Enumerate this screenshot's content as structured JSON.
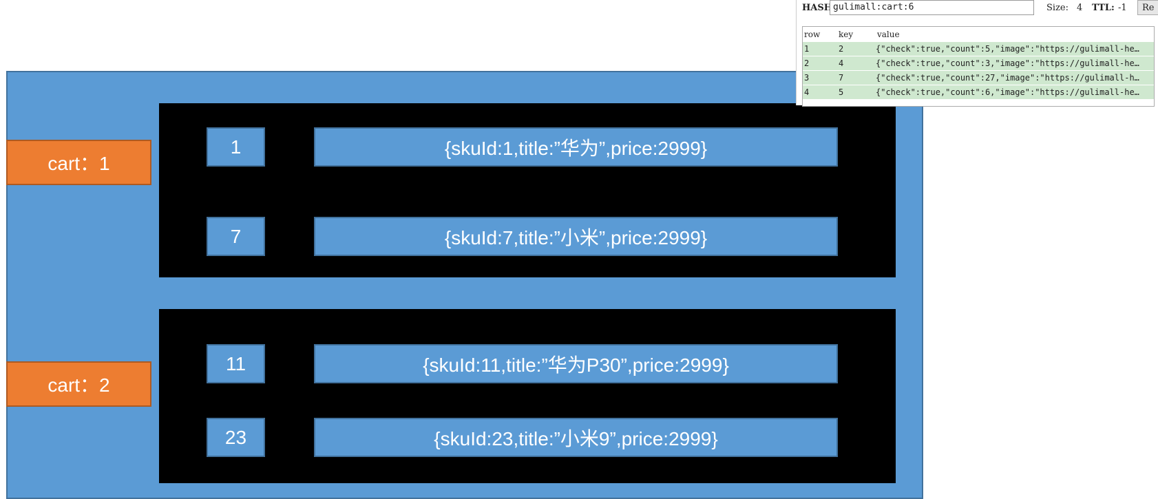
{
  "diagram": {
    "carts": [
      {
        "label": "cart：1",
        "items": [
          {
            "key": "1",
            "value": "{skuId:1,title:”华为”,price:2999}"
          },
          {
            "key": "7",
            "value": "{skuId:7,title:”小米”,price:2999}"
          }
        ]
      },
      {
        "label": "cart：2",
        "items": [
          {
            "key": "11",
            "value": "{skuId:11,title:”华为P30”,price:2999}"
          },
          {
            "key": "23",
            "value": "{skuId:23,title:”小米9”,price:2999}"
          }
        ]
      }
    ]
  },
  "redis_panel": {
    "hash_label": "HASH:",
    "hash_value": "gulimall:cart:6",
    "size_label": "Size:",
    "size_value": "4",
    "ttl_label": "TTL:",
    "ttl_value": "-1",
    "reload_button": "Re",
    "columns": [
      "row",
      "key",
      "value"
    ],
    "rows": [
      {
        "row": "1",
        "key": "2",
        "value": "{\"check\":true,\"count\":5,\"image\":\"https://gulimall-he…"
      },
      {
        "row": "2",
        "key": "4",
        "value": "{\"check\":true,\"count\":3,\"image\":\"https://gulimall-he…"
      },
      {
        "row": "3",
        "key": "7",
        "value": "{\"check\":true,\"count\":27,\"image\":\"https://gulimall-h…"
      },
      {
        "row": "4",
        "key": "5",
        "value": "{\"check\":true,\"count\":6,\"image\":\"https://gulimall-he…"
      }
    ]
  }
}
